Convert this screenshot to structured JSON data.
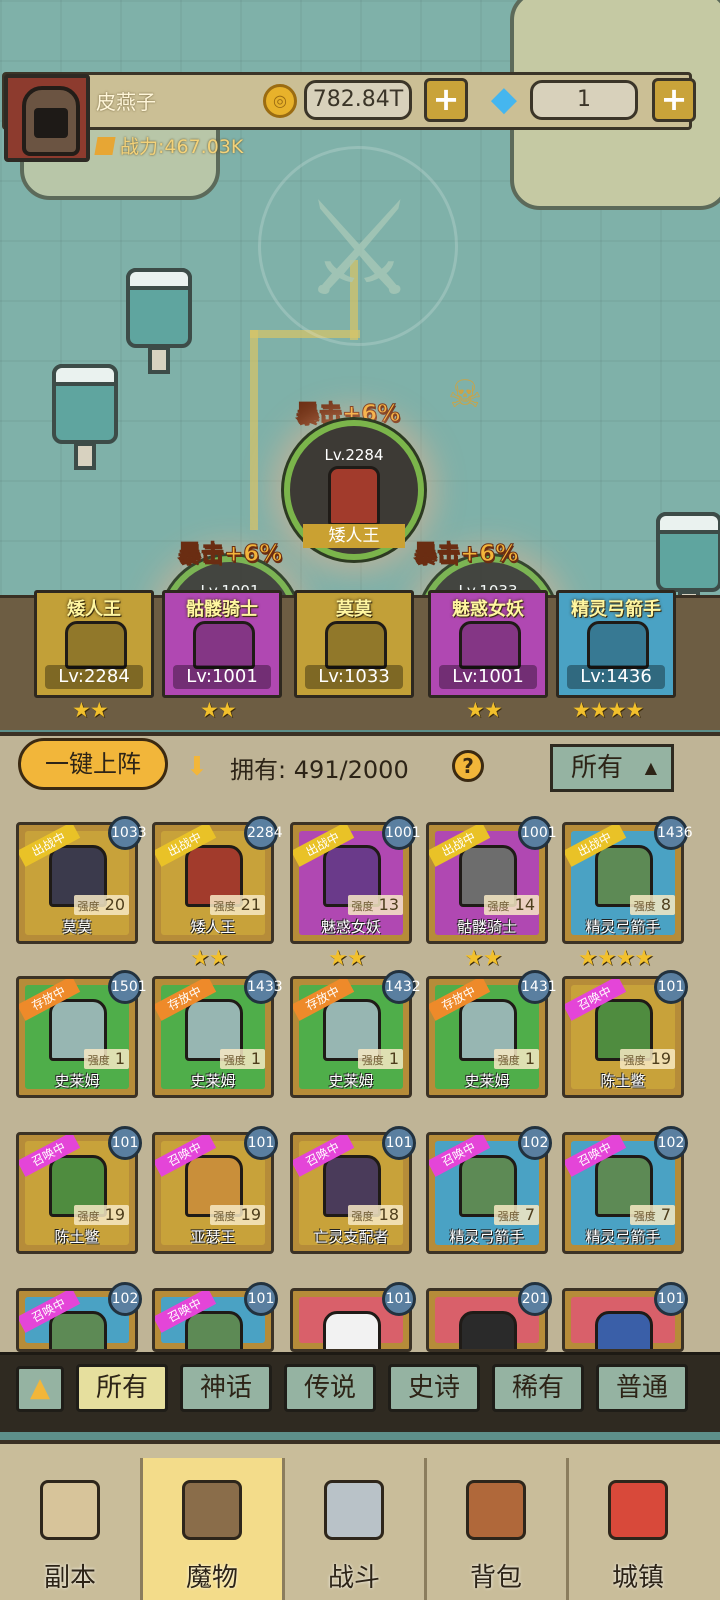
{
  "player": {
    "name": "皮燕子",
    "gold": "782.84T",
    "gems": "1",
    "power_label": "战力:467.03K"
  },
  "icons": {
    "gold": "coin-icon",
    "gem": "diamond-icon",
    "plus": "plus-icon",
    "power": "power-icon",
    "help": "question-icon",
    "sort": "triangle-up-icon"
  },
  "map": {
    "crit_center": "暴击+6%",
    "crit_left": "暴击+6%",
    "crit_right": "暴击+6%",
    "center_bubble": {
      "level": "Lv.2284",
      "name": "矮人王"
    },
    "left_bubble_level": "Lv.1001",
    "right_bubble_level": "Lv.1033"
  },
  "deployed": [
    {
      "name": "矮人王",
      "level": "Lv:2284",
      "stars": "★★",
      "color": "#c2a038"
    },
    {
      "name": "骷髅骑士",
      "level": "Lv:1001",
      "stars": "★★",
      "color": "#b048b2"
    },
    {
      "name": "莫莫",
      "level": "Lv:1033",
      "stars": "",
      "color": "#c2a038"
    },
    {
      "name": "魅惑女妖",
      "level": "Lv:1001",
      "stars": "★★",
      "color": "#b048b2"
    },
    {
      "name": "精灵弓箭手",
      "level": "Lv:1436",
      "stars": "★★★★",
      "color": "#4aa2c4"
    }
  ],
  "controls": {
    "auto_deploy": "一键上阵",
    "own_label": "拥有:",
    "own_count": "491/2000",
    "filter": "所有"
  },
  "monsters": [
    {
      "name": "莫莫",
      "tag": "出战中",
      "level": "1033",
      "strength": "20",
      "bg": "#c8a23a",
      "char": "#3b3a4c",
      "stars": ""
    },
    {
      "name": "矮人王",
      "tag": "出战中",
      "level": "2284",
      "strength": "21",
      "bg": "#c8a23a",
      "char": "#a23b2c",
      "stars": "★★"
    },
    {
      "name": "魅惑女妖",
      "tag": "出战中",
      "level": "1001",
      "strength": "13",
      "bg": "#b048b2",
      "char": "#6a3a8a",
      "stars": "★★"
    },
    {
      "name": "骷髅骑士",
      "tag": "出战中",
      "level": "1001",
      "strength": "14",
      "bg": "#b048b2",
      "char": "#6d6d6d",
      "stars": "★★"
    },
    {
      "name": "精灵弓箭手",
      "tag": "出战中",
      "level": "1436",
      "strength": "8",
      "bg": "#4aa2c4",
      "char": "#5d8a55",
      "stars": "★★★★"
    },
    {
      "name": "史莱姆",
      "tag": "存放中",
      "level": "1501",
      "strength": "1",
      "bg": "#4fae4a",
      "char": "#97b6b2",
      "stars": ""
    },
    {
      "name": "史莱姆",
      "tag": "存放中",
      "level": "1433",
      "strength": "1",
      "bg": "#4fae4a",
      "char": "#97b6b2",
      "stars": ""
    },
    {
      "name": "史莱姆",
      "tag": "存放中",
      "level": "1432",
      "strength": "1",
      "bg": "#4fae4a",
      "char": "#97b6b2",
      "stars": ""
    },
    {
      "name": "史莱姆",
      "tag": "存放中",
      "level": "1431",
      "strength": "1",
      "bg": "#4fae4a",
      "char": "#97b6b2",
      "stars": ""
    },
    {
      "name": "陈土鳖",
      "tag": "召唤中",
      "level": "101",
      "strength": "19",
      "bg": "#c8a23a",
      "char": "#4f8c3f",
      "stars": ""
    },
    {
      "name": "陈土鳖",
      "tag": "召唤中",
      "level": "101",
      "strength": "19",
      "bg": "#c8a23a",
      "char": "#4f8c3f",
      "stars": ""
    },
    {
      "name": "亚瑟王",
      "tag": "召唤中",
      "level": "101",
      "strength": "19",
      "bg": "#c8a23a",
      "char": "#c98f3a",
      "stars": ""
    },
    {
      "name": "亡灵支配者",
      "tag": "召唤中",
      "level": "101",
      "strength": "18",
      "bg": "#c8a23a",
      "char": "#4a3b5a",
      "stars": ""
    },
    {
      "name": "精灵弓箭手",
      "tag": "召唤中",
      "level": "102",
      "strength": "7",
      "bg": "#4aa2c4",
      "char": "#5d8a55",
      "stars": ""
    },
    {
      "name": "精灵弓箭手",
      "tag": "召唤中",
      "level": "102",
      "strength": "7",
      "bg": "#4aa2c4",
      "char": "#5d8a55",
      "stars": ""
    },
    {
      "name": "",
      "tag": "召唤中",
      "level": "102",
      "strength": "",
      "bg": "#4aa2c4",
      "char": "#5d8a55",
      "stars": ""
    },
    {
      "name": "",
      "tag": "召唤中",
      "level": "101",
      "strength": "",
      "bg": "#4aa2c4",
      "char": "#5d8a55",
      "stars": ""
    },
    {
      "name": "",
      "tag": "",
      "level": "101",
      "strength": "",
      "bg": "#d9606a",
      "char": "#f2f2f2",
      "stars": ""
    },
    {
      "name": "",
      "tag": "",
      "level": "201",
      "strength": "",
      "bg": "#d9606a",
      "char": "#2a2a2a",
      "stars": ""
    },
    {
      "name": "",
      "tag": "",
      "level": "101",
      "strength": "",
      "bg": "#d9606a",
      "char": "#3a5fa8",
      "stars": ""
    }
  ],
  "strength_label": "强度",
  "tag_colors": {
    "出战中": "#e9c227",
    "存放中": "#ee8a2a",
    "召唤中": "#e445d8"
  },
  "rarity_tabs": [
    "所有",
    "神话",
    "传说",
    "史诗",
    "稀有",
    "普通"
  ],
  "nav": [
    {
      "label": "副本",
      "icon": "map-icon",
      "color": "#d7c49a"
    },
    {
      "label": "魔物",
      "icon": "helmet-icon",
      "color": "#8a6d4a"
    },
    {
      "label": "战斗",
      "icon": "swords-icon",
      "color": "#b9c2c8"
    },
    {
      "label": "背包",
      "icon": "backpack-icon",
      "color": "#b0683a"
    },
    {
      "label": "城镇",
      "icon": "shop-icon",
      "color": "#d8493a"
    }
  ]
}
